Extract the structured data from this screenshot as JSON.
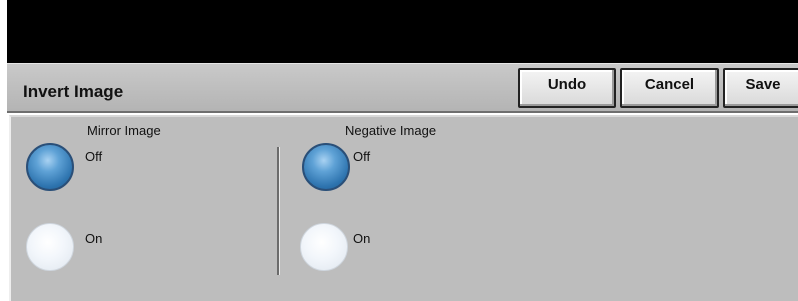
{
  "header": {
    "title": "Invert Image",
    "buttons": {
      "undo": "Undo",
      "cancel": "Cancel",
      "save": "Save"
    }
  },
  "mirror_image": {
    "label": "Mirror Image",
    "options": [
      {
        "label": "Off",
        "selected": true
      },
      {
        "label": "On",
        "selected": false
      }
    ]
  },
  "negative_image": {
    "label": "Negative Image",
    "options": [
      {
        "label": "Off",
        "selected": true
      },
      {
        "label": "On",
        "selected": false
      }
    ]
  },
  "colors": {
    "selected_radio": "#2d73ae",
    "panel_bg": "#bdbdbd",
    "top_bar": "#000000"
  }
}
